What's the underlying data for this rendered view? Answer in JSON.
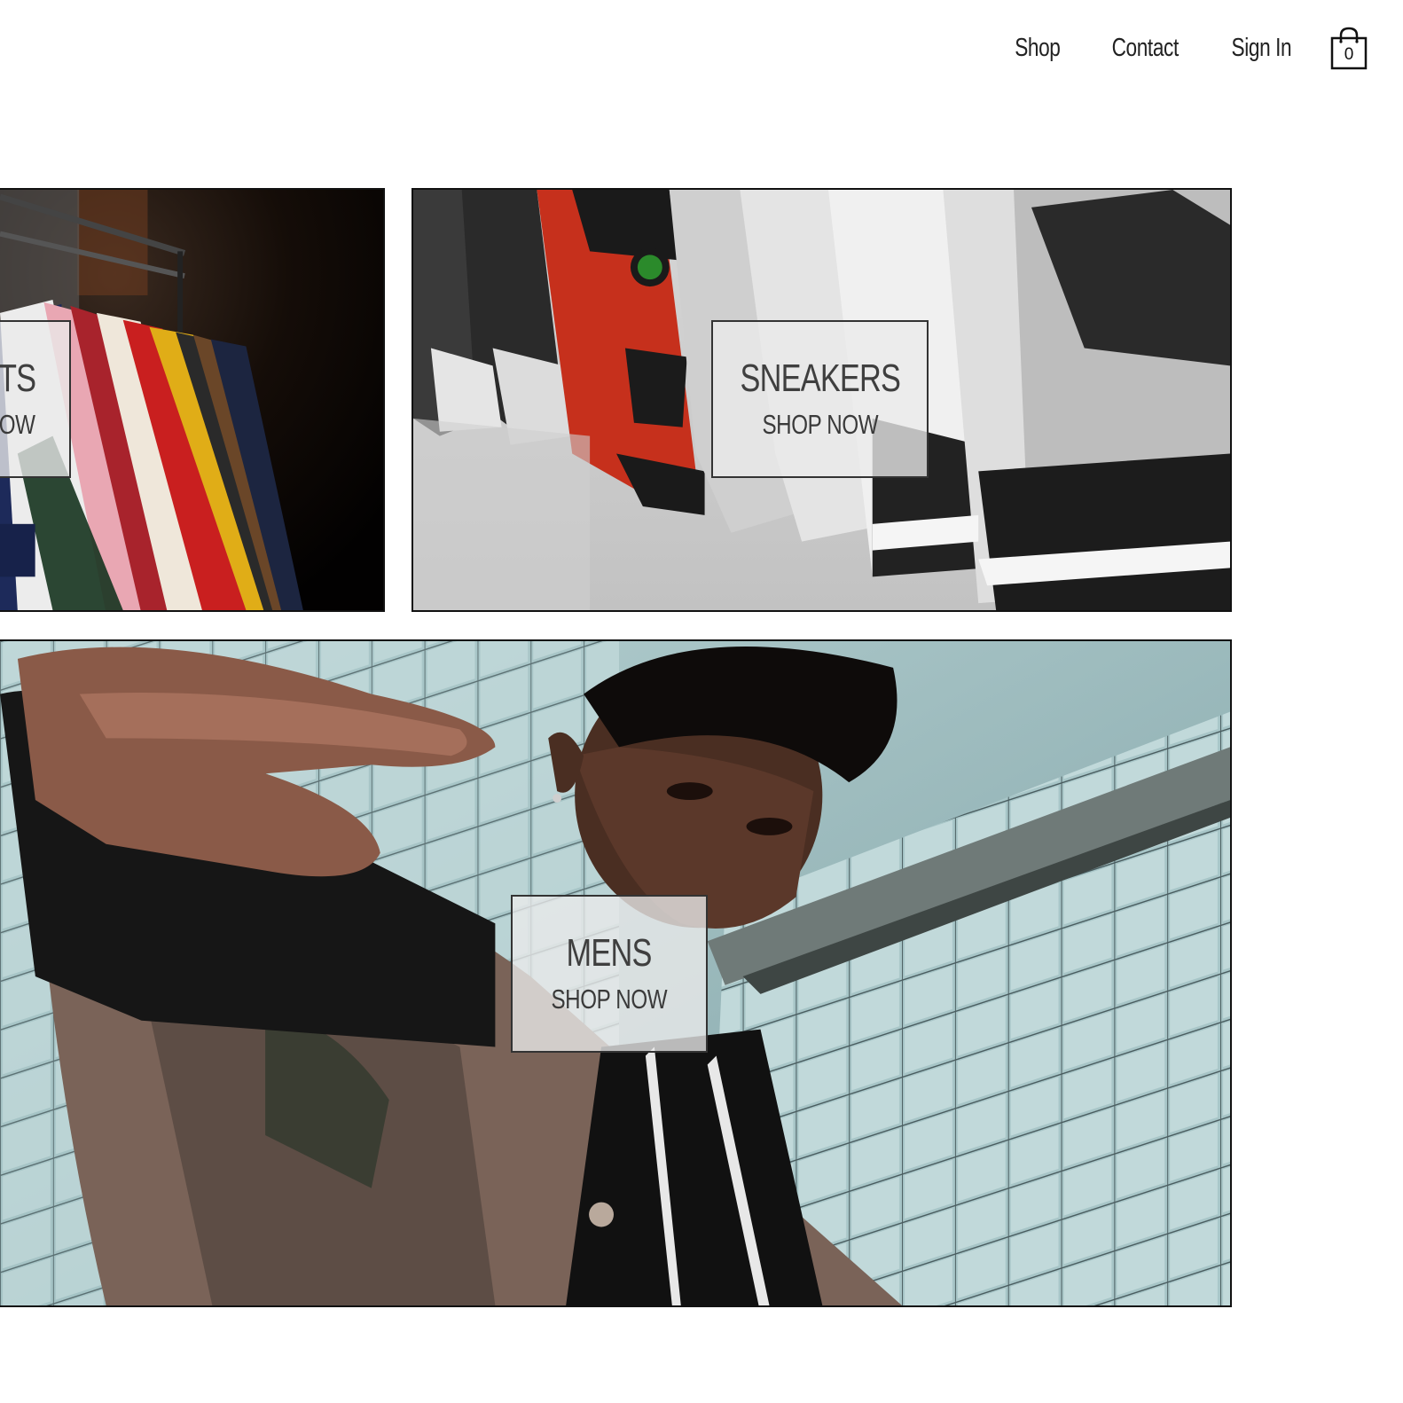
{
  "nav": {
    "links": [
      "Shop",
      "Contact",
      "Sign In"
    ],
    "cart": {
      "icon": "shopping-bag-icon",
      "count": "0"
    }
  },
  "tiles": {
    "jackets": {
      "title": "JACKETS",
      "cta": "SHOP NOW",
      "visible_title": "TS",
      "visible_cta": "OW"
    },
    "sneakers": {
      "title": "SNEAKERS",
      "cta": "SHOP NOW"
    },
    "mens": {
      "title": "MENS",
      "cta": "SHOP NOW"
    }
  },
  "colors": {
    "text": "#222222",
    "border": "#111111",
    "label_bg": "#ebebeb"
  }
}
